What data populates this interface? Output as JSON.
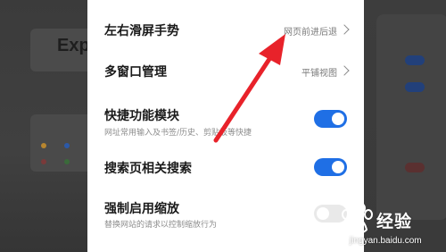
{
  "background": {
    "left_title_fragment": "Exp"
  },
  "settings": {
    "items": [
      {
        "title": "左右滑屏手势",
        "value": "网页前进后退",
        "control": "chevron"
      },
      {
        "title": "多窗口管理",
        "value": "平铺视图",
        "control": "chevron"
      },
      {
        "title": "快捷功能模块",
        "subtitle": "网址常用输入及书签/历史、剪贴板等快捷",
        "control": "toggle",
        "state": "on"
      },
      {
        "title": "搜索页相关搜索",
        "control": "toggle",
        "state": "on"
      },
      {
        "title": "强制启用缩放",
        "subtitle": "替换网站的请求以控制缩放行为",
        "control": "toggle",
        "state": "off"
      }
    ]
  },
  "colors": {
    "toggle_on": "#1f6fe5",
    "toggle_off": "#e9e9e9",
    "annotation_arrow": "#e8222a"
  },
  "watermark": {
    "brand_text": "经验",
    "url": "jingyan.baidu.com"
  }
}
